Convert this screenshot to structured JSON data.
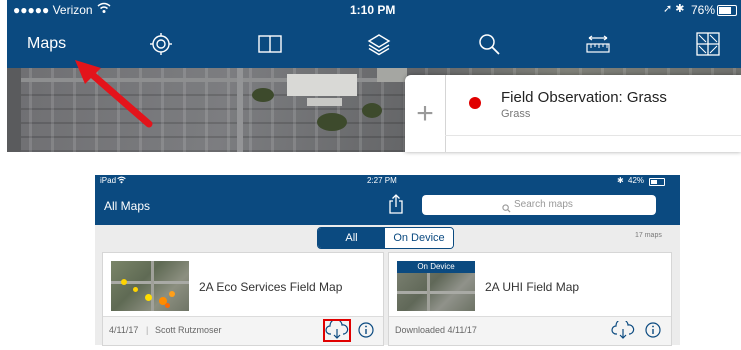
{
  "top_screenshot": {
    "status": {
      "carrier": "●●●●● Verizon",
      "time": "1:10 PM",
      "battery": "76%"
    },
    "nav": {
      "maps_label": "Maps",
      "icons": [
        "locate-icon",
        "book-icon",
        "layers-icon",
        "search-icon",
        "measure-icon",
        "grid-icon"
      ]
    },
    "popup": {
      "title": "Field Observation: Grass",
      "subtitle": "Grass"
    },
    "colors": {
      "bar": "#0b4a80",
      "dot": "#e00000",
      "arrow": "#e3141b"
    }
  },
  "bottom_screenshot": {
    "status": {
      "device": "iPad",
      "time": "2:27 PM",
      "battery": "42%"
    },
    "nav": {
      "title": "All Maps",
      "search_placeholder": "Search maps"
    },
    "segment": {
      "all_label": "All",
      "device_label": "On Device",
      "active": "All"
    },
    "count": "17 maps",
    "cards": [
      {
        "title": "2A Eco Services Field Map",
        "date": "4/11/17",
        "author": "Scott Rutzmoser"
      },
      {
        "title": "2A UHI Field Map",
        "badge": "On Device",
        "status": "Downloaded 4/11/17"
      }
    ],
    "colors": {
      "bar": "#0b4a80",
      "highlight": "#e00000"
    }
  }
}
